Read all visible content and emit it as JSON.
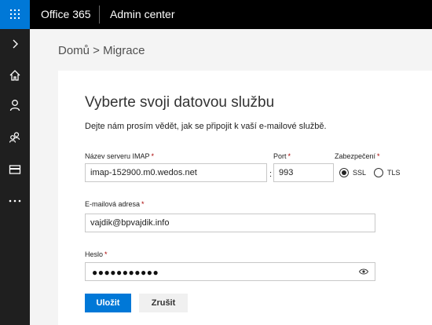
{
  "topbar": {
    "brand": "Office 365",
    "app": "Admin center"
  },
  "breadcrumb": "Domů > Migrace",
  "form": {
    "title": "Vyberte svoji datovou službu",
    "subtitle": "Dejte nám prosím vědět, jak se připojit k vaší e-mailové službě.",
    "server": {
      "label": "Název serveru IMAP",
      "value": "imap-152900.m0.wedos.net"
    },
    "port": {
      "label": "Port",
      "value": "993"
    },
    "security": {
      "label": "Zabezpečení",
      "options": [
        "SSL",
        "TLS"
      ],
      "selected": "SSL"
    },
    "email": {
      "label": "E-mailová adresa",
      "value": "vajdik@bpvajdik.info"
    },
    "password": {
      "label": "Heslo",
      "masked": "●●●●●●●●●●●"
    },
    "required_mark": "*",
    "colon": ":",
    "save_label": "Uložit",
    "cancel_label": "Zrušit"
  },
  "rail": {
    "icons": [
      "chevron-right-icon",
      "home-icon",
      "user-icon",
      "groups-icon",
      "billing-icon",
      "more-icon"
    ]
  },
  "colors": {
    "accent": "#0078d7",
    "topbar": "#000000",
    "rail": "#1f1f1f",
    "background": "#f4f4f4"
  }
}
